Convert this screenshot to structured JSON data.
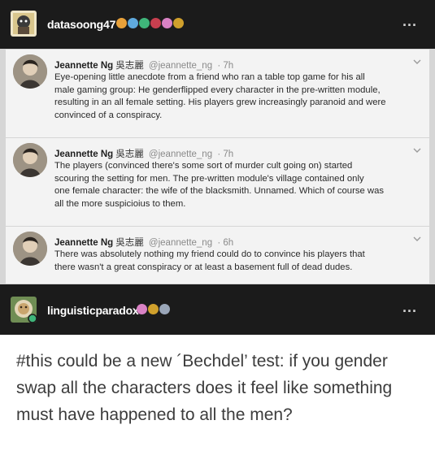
{
  "post1": {
    "username": "datasoong47",
    "more_label": "..."
  },
  "tweets": [
    {
      "name": "Jeannette Ng",
      "hanzi": "吳志麗",
      "handle": "@jeannette_ng",
      "time": "· 7h",
      "lines": [
        "Eye-opening little anecdote from a friend who ran a table top game for his all",
        "male gaming group: He genderflipped every character in the pre-written module,",
        "resulting in an all female setting. His players grew increasingly paranoid and were",
        "convinced of a conspiracy."
      ]
    },
    {
      "name": "Jeannette Ng",
      "hanzi": "吳志麗",
      "handle": "@jeannette_ng",
      "time": "· 7h",
      "lines": [
        "The players (convinced there's some sort of murder cult going on) started",
        "scouring the setting for men. The pre-written module's village contained only",
        "one female character: the wife of the blacksmith. Unnamed. Which of course was",
        "all the more suspicioius to them."
      ]
    },
    {
      "name": "Jeannette Ng",
      "hanzi": "吳志麗",
      "handle": "@jeannette_ng",
      "time": "· 6h",
      "lines": [
        "There was absolutely nothing my friend could do to convince his players that",
        "there wasn't a great conspiracy or at least a basement full of dead dudes."
      ]
    }
  ],
  "post2": {
    "username": "linguisticparadox",
    "more_label": "...",
    "text": "#this could be a new ´Bechdel’ test: if you gender swap all the characters does it feel like something must have happened to all the men?"
  },
  "colors": {
    "header_bg": "#1b1b1b",
    "tweet_bg": "#f3f3f3",
    "body_bg": "#ffffff"
  }
}
